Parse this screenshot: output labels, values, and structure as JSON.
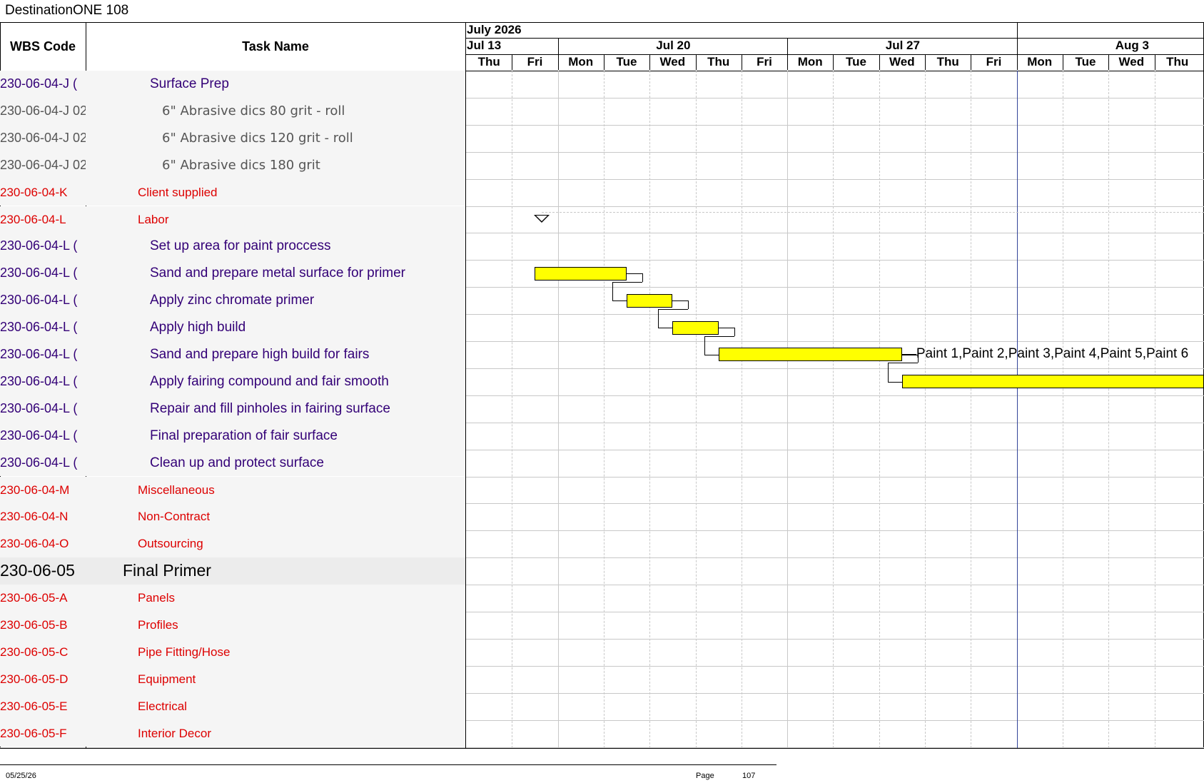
{
  "document": {
    "title": "DestinationONE 108"
  },
  "columns": {
    "wbs": "WBS Code",
    "task": "Task Name"
  },
  "calendar": {
    "month": "July 2026",
    "weeks": [
      "Jul 13",
      "Jul 20",
      "Jul 27",
      "Aug 3"
    ],
    "days": [
      "Thu",
      "Fri",
      "Mon",
      "Tue",
      "Wed",
      "Thu",
      "Fri",
      "Mon",
      "Tue",
      "Wed",
      "Thu",
      "Fri",
      "Mon",
      "Tue",
      "Wed",
      "Thu"
    ]
  },
  "rows": [
    {
      "code": "230-06-04-J (",
      "name": "Surface Prep",
      "style": "task",
      "indent": 90
    },
    {
      "code": "230-06-04-J 02",
      "name": "6\" Abrasive dics 80 grit - roll",
      "style": "material",
      "indent": 107
    },
    {
      "code": "230-06-04-J 02",
      "name": "6\" Abrasive dics 120 grit - roll",
      "style": "material",
      "indent": 107
    },
    {
      "code": "230-06-04-J 02",
      "name": "6\" Abrasive dics 180 grit",
      "style": "material",
      "indent": 107
    },
    {
      "code": "230-06-04-K",
      "name": "Client supplied",
      "style": "category",
      "indent": 73
    },
    {
      "code": "230-06-04-L",
      "name": "Labor",
      "style": "category",
      "indent": 73
    },
    {
      "code": "230-06-04-L (",
      "name": "Set up area for paint proccess",
      "style": "task",
      "indent": 90
    },
    {
      "code": "230-06-04-L (",
      "name": "Sand and prepare metal surface for primer",
      "style": "task",
      "indent": 90
    },
    {
      "code": "230-06-04-L (",
      "name": "Apply zinc chromate primer",
      "style": "task",
      "indent": 90
    },
    {
      "code": "230-06-04-L (",
      "name": "Apply high build",
      "style": "task",
      "indent": 90
    },
    {
      "code": "230-06-04-L (",
      "name": "Sand and prepare high build for fairs",
      "style": "task",
      "indent": 90
    },
    {
      "code": "230-06-04-L (",
      "name": "Apply fairing compound and fair smooth",
      "style": "task",
      "indent": 90
    },
    {
      "code": "230-06-04-L (",
      "name": "Repair and fill pinholes in fairing surface",
      "style": "task",
      "indent": 90
    },
    {
      "code": "230-06-04-L (",
      "name": "Final preparation of fair surface",
      "style": "task",
      "indent": 90
    },
    {
      "code": "230-06-04-L (",
      "name": "Clean up and protect surface",
      "style": "task",
      "indent": 90
    },
    {
      "code": "230-06-04-M",
      "name": "Miscellaneous",
      "style": "category",
      "indent": 73
    },
    {
      "code": "230-06-04-N",
      "name": "Non-Contract",
      "style": "category",
      "indent": 73
    },
    {
      "code": "230-06-04-O",
      "name": "Outsourcing",
      "style": "category",
      "indent": 73
    },
    {
      "code": "230-06-05",
      "name": "Final Primer",
      "style": "phase",
      "indent": 52
    },
    {
      "code": "230-06-05-A",
      "name": "Panels",
      "style": "category",
      "indent": 73
    },
    {
      "code": "230-06-05-B",
      "name": "Profiles",
      "style": "category",
      "indent": 73
    },
    {
      "code": "230-06-05-C",
      "name": "Pipe Fitting/Hose",
      "style": "category",
      "indent": 73
    },
    {
      "code": "230-06-05-D",
      "name": "Equipment",
      "style": "category",
      "indent": 73
    },
    {
      "code": "230-06-05-E",
      "name": "Electrical",
      "style": "category",
      "indent": 73
    },
    {
      "code": "230-06-05-F",
      "name": "Interior Decor",
      "style": "category",
      "indent": 73
    }
  ],
  "gantt": {
    "bars": [
      {
        "row": 7,
        "start": 1.5,
        "end": 3.5
      },
      {
        "row": 8,
        "start": 3.5,
        "end": 4.5
      },
      {
        "row": 9,
        "start": 4.5,
        "end": 5.5
      },
      {
        "row": 10,
        "start": 5.5,
        "end": 9.5
      },
      {
        "row": 11,
        "start": 9.5,
        "end": 16.2
      }
    ],
    "resource_label": {
      "row": 10,
      "text": "Paint 1,Paint 2,Paint 3,Paint 4,Paint 5,Paint 6"
    },
    "summary_marker": {
      "row": 5,
      "at": 1.65
    }
  },
  "footer": {
    "date": "05/25/26",
    "page_label": "Page",
    "page_number": "107"
  },
  "colors": {
    "task": "#330077",
    "material": "#555555",
    "category": "#dd0000",
    "phase": "#000000",
    "bar": "#ffff00",
    "today_line": "#334499"
  }
}
